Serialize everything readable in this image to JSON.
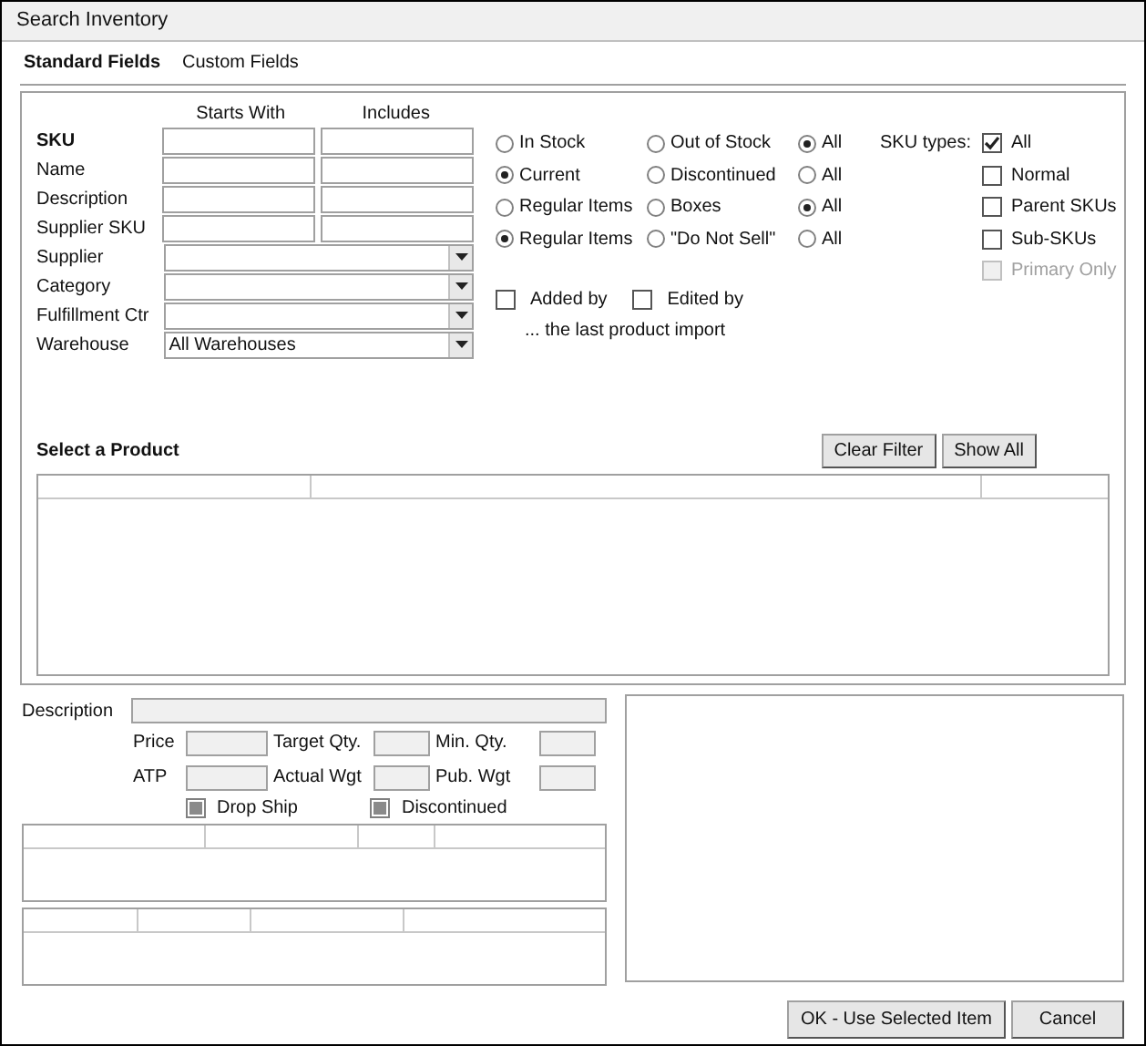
{
  "window": {
    "title": "Search Inventory"
  },
  "tabs": [
    {
      "label": "Standard Fields",
      "selected": true
    },
    {
      "label": "Custom Fields",
      "selected": false
    }
  ],
  "filters": {
    "headers": [
      "Starts With",
      "Includes"
    ],
    "rows": [
      {
        "label": "SKU",
        "kind": "text",
        "emphasized": true
      },
      {
        "label": "Name",
        "kind": "text",
        "emphasized": false
      },
      {
        "label": "Description",
        "kind": "text",
        "emphasized": false
      },
      {
        "label": "Supplier SKU",
        "kind": "text",
        "emphasized": false
      },
      {
        "label": "Supplier",
        "kind": "combo",
        "emphasized": false
      },
      {
        "label": "Category",
        "kind": "combo",
        "emphasized": false
      },
      {
        "label": "Fulfillment Ctr",
        "kind": "combo",
        "emphasized": false
      },
      {
        "label": "Warehouse",
        "kind": "combo",
        "emphasized": false,
        "value": "All Warehouses"
      }
    ]
  },
  "radio_groups": [
    {
      "options": [
        {
          "label": "In Stock",
          "selected": false
        },
        {
          "label": "Out of Stock",
          "selected": false
        },
        {
          "label": "All",
          "selected": true
        }
      ]
    },
    {
      "options": [
        {
          "label": "Current",
          "selected": true
        },
        {
          "label": "Discontinued",
          "selected": false
        },
        {
          "label": "All",
          "selected": false
        }
      ]
    },
    {
      "options": [
        {
          "label": "Regular Items",
          "selected": false
        },
        {
          "label": "Boxes",
          "selected": false
        },
        {
          "label": "All",
          "selected": true
        }
      ]
    },
    {
      "options": [
        {
          "label": "Regular Items",
          "selected": true
        },
        {
          "label": "\"Do Not Sell\"",
          "selected": false
        },
        {
          "label": "All",
          "selected": false
        }
      ]
    }
  ],
  "import_checks": [
    {
      "label": "Added by",
      "checked": false
    },
    {
      "label": "Edited by",
      "checked": false
    }
  ],
  "import_note": "... the last product import",
  "sku_types": {
    "label": "SKU types:",
    "options": [
      {
        "label": "All",
        "checked": true,
        "disabled": false
      },
      {
        "label": "Normal",
        "checked": false,
        "disabled": false
      },
      {
        "label": "Parent SKUs",
        "checked": false,
        "disabled": false
      },
      {
        "label": "Sub-SKUs",
        "checked": false,
        "disabled": false
      },
      {
        "label": "Primary Only",
        "checked": false,
        "disabled": true
      }
    ]
  },
  "product_section": {
    "title": "Select a Product",
    "buttons": [
      "Clear Filter",
      "Show All"
    ]
  },
  "details": {
    "description_label": "Description",
    "fields": [
      {
        "label": "Price"
      },
      {
        "label": "Target Qty."
      },
      {
        "label": "Min. Qty."
      },
      {
        "label": "ATP"
      },
      {
        "label": "Actual Wgt"
      },
      {
        "label": "Pub. Wgt"
      }
    ],
    "checks": [
      {
        "label": "Drop Ship",
        "indeterminate": true
      },
      {
        "label": "Discontinued",
        "indeterminate": true
      }
    ]
  },
  "buttons": [
    "OK - Use Selected Item",
    "Cancel"
  ]
}
